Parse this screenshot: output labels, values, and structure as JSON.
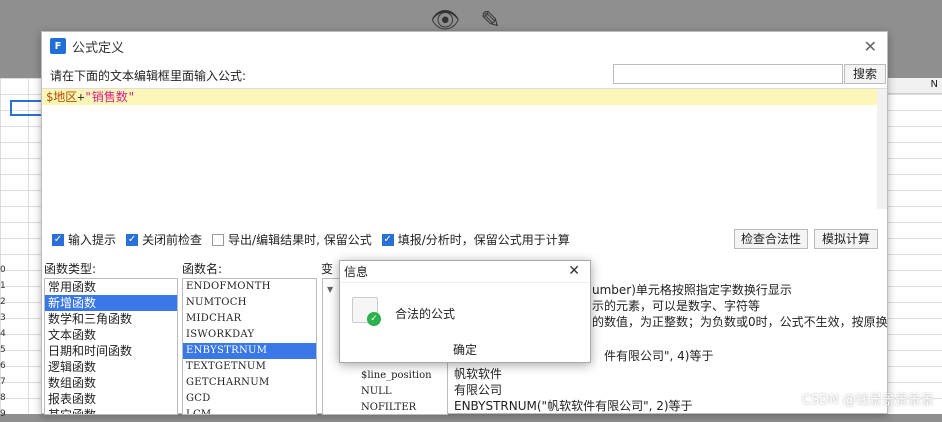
{
  "window": {
    "title": "公式定义",
    "prompt": "请在下面的文本编辑框里面输入公式:",
    "search_placeholder": "",
    "search_button": "搜索"
  },
  "editor": {
    "var": "$地区",
    "op": "+",
    "str": "\"销售数\""
  },
  "options": [
    {
      "label": "输入提示",
      "checked": true
    },
    {
      "label": "关闭前检查",
      "checked": true
    },
    {
      "label": "导出/编辑结果时, 保留公式",
      "checked": false
    },
    {
      "label": "填报/分析时，保留公式用于计算",
      "checked": true
    }
  ],
  "buttons": {
    "check_validity": "检查合法性",
    "simulate": "模拟计算"
  },
  "labels": {
    "func_type": "函数类型:",
    "func_name": "函数名:",
    "variable": "变"
  },
  "func_types": [
    {
      "label": "常用函数",
      "selected": false
    },
    {
      "label": "新增函数",
      "selected": true
    },
    {
      "label": "数学和三角函数",
      "selected": false
    },
    {
      "label": "文本函数",
      "selected": false
    },
    {
      "label": "日期和时间函数",
      "selected": false
    },
    {
      "label": "逻辑函数",
      "selected": false
    },
    {
      "label": "数组函数",
      "selected": false
    },
    {
      "label": "报表函数",
      "selected": false
    },
    {
      "label": "其它函数",
      "selected": false
    }
  ],
  "func_names": [
    {
      "label": "ENDOFMONTH",
      "selected": false
    },
    {
      "label": "NUMTOCH",
      "selected": false
    },
    {
      "label": "MIDCHAR",
      "selected": false
    },
    {
      "label": "ISWORKDAY",
      "selected": false
    },
    {
      "label": "ENBYSTRNUM",
      "selected": true
    },
    {
      "label": "TEXTGETNUM",
      "selected": false
    },
    {
      "label": "GETCHARNUM",
      "selected": false
    },
    {
      "label": "GCD",
      "selected": false
    },
    {
      "label": "LCM",
      "selected": false
    }
  ],
  "variables": [
    "$line_position",
    "NULL",
    "NOFILTER"
  ],
  "description": [
    "umber)单元格按照指定字数换行显示",
    "示的元素，可以是数字、字符等",
    "的数值，为正整数；为负数或0时，公式不生效，按原换",
    "件有限公司\", 4)等于",
    "帆软软件",
    "有限公司",
    "ENBYSTRNUM(\"帆软软件有限公司\", 2)等于"
  ],
  "popup": {
    "title": "信息",
    "message": "合法的公式",
    "ok": "确定"
  },
  "sheet": {
    "row_numbers": [
      "0",
      "1",
      "2",
      "3",
      "4",
      "5",
      "6",
      "7",
      "8",
      "9"
    ],
    "col_header": "N"
  },
  "watermark": "CSDN @钱景景景景景"
}
